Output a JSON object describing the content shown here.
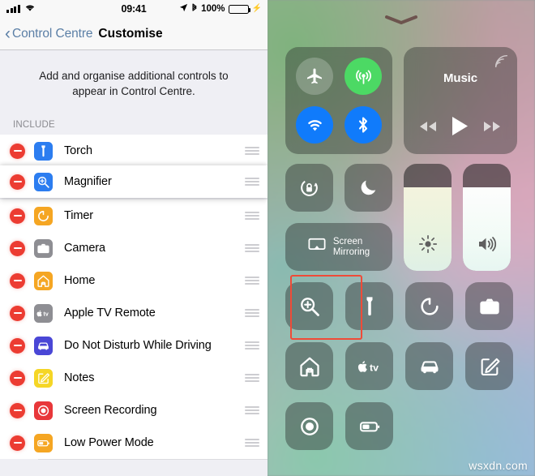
{
  "left": {
    "status_bar": {
      "signal_icon": "cellular-bars-icon",
      "wifi_icon": "wifi-icon",
      "time": "09:41",
      "location_icon": "location-arrow-icon",
      "bluetooth_icon": "bluetooth-icon",
      "battery_percent": "100%",
      "battery_icon": "battery-full-icon",
      "charging_icon": "charging-bolt-icon"
    },
    "nav": {
      "back_icon": "chevron-left-icon",
      "back_label": "Control Centre",
      "title": "Customise"
    },
    "description": "Add and organise additional controls to appear in Control Centre.",
    "section_label": "INCLUDE",
    "rows": [
      {
        "label": "Torch",
        "icon": "torch-icon",
        "icon_color": "#2c7df0",
        "remove_icon": "remove-minus-icon",
        "handle_icon": "reorder-handle-icon",
        "dragging": false
      },
      {
        "label": "Magnifier",
        "icon": "magnifier-icon",
        "icon_color": "#2c7df0",
        "remove_icon": "remove-minus-icon",
        "handle_icon": "reorder-handle-icon",
        "dragging": true
      },
      {
        "label": "Timer",
        "icon": "timer-icon",
        "icon_color": "#f5a623",
        "remove_icon": "remove-minus-icon",
        "handle_icon": "reorder-handle-icon",
        "dragging": false
      },
      {
        "label": "Camera",
        "icon": "camera-icon",
        "icon_color": "#8e8e93",
        "remove_icon": "remove-minus-icon",
        "handle_icon": "reorder-handle-icon",
        "dragging": false
      },
      {
        "label": "Home",
        "icon": "home-icon",
        "icon_color": "#f5a623",
        "remove_icon": "remove-minus-icon",
        "handle_icon": "reorder-handle-icon",
        "dragging": false
      },
      {
        "label": "Apple TV Remote",
        "icon": "apple-tv-icon",
        "icon_color": "#8e8e93",
        "remove_icon": "remove-minus-icon",
        "handle_icon": "reorder-handle-icon",
        "dragging": false
      },
      {
        "label": "Do Not Disturb While Driving",
        "icon": "car-icon",
        "icon_color": "#4a47d6",
        "remove_icon": "remove-minus-icon",
        "handle_icon": "reorder-handle-icon",
        "dragging": false
      },
      {
        "label": "Notes",
        "icon": "notes-pencil-icon",
        "icon_color": "#f5d626",
        "remove_icon": "remove-minus-icon",
        "handle_icon": "reorder-handle-icon",
        "dragging": false
      },
      {
        "label": "Screen Recording",
        "icon": "screen-recording-icon",
        "icon_color": "#e8373a",
        "remove_icon": "remove-minus-icon",
        "handle_icon": "reorder-handle-icon",
        "dragging": false
      },
      {
        "label": "Low Power Mode",
        "icon": "battery-low-icon",
        "icon_color": "#f5a623",
        "remove_icon": "remove-minus-icon",
        "handle_icon": "reorder-handle-icon",
        "dragging": false
      }
    ]
  },
  "right": {
    "grabber_icon": "chevron-down-grabber-icon",
    "connectivity": [
      {
        "name": "airplane-mode-toggle",
        "icon": "airplane-icon",
        "state": "off",
        "color": "#ffffff3a"
      },
      {
        "name": "cellular-data-toggle",
        "icon": "cellular-icon",
        "state": "on",
        "color": "#4cd964"
      },
      {
        "name": "wifi-toggle",
        "icon": "wifi-icon",
        "state": "on",
        "color": "#107bfb"
      },
      {
        "name": "bluetooth-toggle",
        "icon": "bluetooth-icon",
        "state": "on",
        "color": "#107bfb"
      }
    ],
    "music": {
      "title": "Music",
      "airplay_icon": "airplay-audio-icon",
      "previous_icon": "rewind-icon",
      "play_icon": "play-icon",
      "next_icon": "fast-forward-icon"
    },
    "tiles_row2": [
      {
        "name": "rotation-lock-toggle",
        "icon": "rotation-lock-icon"
      },
      {
        "name": "do-not-disturb-toggle",
        "icon": "moon-icon"
      }
    ],
    "screen_mirroring": {
      "label": "Screen\nMirroring",
      "label_line1": "Screen",
      "label_line2": "Mirroring",
      "icon": "airplay-screen-icon"
    },
    "brightness_slider": {
      "name": "brightness-slider",
      "icon": "brightness-sun-icon",
      "value": 78
    },
    "volume_slider": {
      "name": "volume-slider",
      "icon": "volume-speaker-icon",
      "value": 78
    },
    "grid_tiles": [
      {
        "name": "magnifier-tile",
        "icon": "magnifier-icon",
        "highlighted": true
      },
      {
        "name": "torch-tile",
        "icon": "torch-icon",
        "highlighted": false
      },
      {
        "name": "timer-tile",
        "icon": "timer-icon",
        "highlighted": false
      },
      {
        "name": "camera-tile",
        "icon": "camera-icon",
        "highlighted": false
      },
      {
        "name": "home-tile",
        "icon": "home-icon",
        "highlighted": false
      },
      {
        "name": "apple-tv-remote-tile",
        "icon": "apple-tv-icon",
        "highlighted": false
      },
      {
        "name": "dnd-driving-tile",
        "icon": "car-icon",
        "highlighted": false
      },
      {
        "name": "notes-tile",
        "icon": "notes-pencil-icon",
        "highlighted": false
      },
      {
        "name": "screen-recording-tile",
        "icon": "screen-recording-icon",
        "highlighted": false
      },
      {
        "name": "low-power-mode-tile",
        "icon": "battery-low-icon",
        "highlighted": false
      }
    ],
    "highlight_color": "#ef4b38",
    "watermark": "wsxdn.com"
  }
}
